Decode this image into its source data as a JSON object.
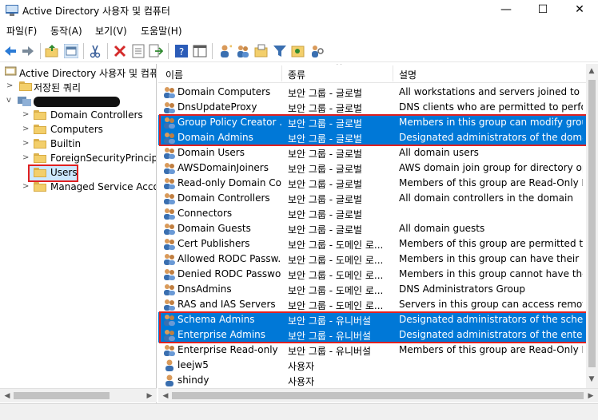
{
  "window": {
    "title": "Active Directory 사용자 및 컴퓨터",
    "minimize": "—",
    "maximize": "☐",
    "close": "✕"
  },
  "menu": [
    "파일(F)",
    "동작(A)",
    "보기(V)",
    "도움말(H)"
  ],
  "tree": {
    "root": "Active Directory 사용자 및 컴퓨터",
    "saved_queries": "저장된 쿼리",
    "domain_redacted": "",
    "children": [
      "Domain Controllers",
      "Computers",
      "Builtin",
      "ForeignSecurityPrincipal",
      "Users",
      "Managed Service Accou"
    ]
  },
  "list": {
    "headers": {
      "name": "이름",
      "type": "종류",
      "desc": "설명"
    },
    "rows": [
      {
        "name": "Domain Computers",
        "type": "보안 그룹 - 글로벌",
        "desc": "All workstations and servers joined to the...",
        "icon": "group-icon",
        "selected": false
      },
      {
        "name": "DnsUpdateProxy",
        "type": "보안 그룹 - 글로벌",
        "desc": "DNS clients who are permitted to perfor...",
        "icon": "group-icon",
        "selected": false
      },
      {
        "name": "Group Policy Creator ...",
        "type": "보안 그룹 - 글로벌",
        "desc": "Members in this group can modify grou...",
        "icon": "group-icon",
        "selected": true
      },
      {
        "name": "Domain Admins",
        "type": "보안 그룹 - 글로벌",
        "desc": "Designated administrators of the domain",
        "icon": "group-icon",
        "selected": true
      },
      {
        "name": "Domain Users",
        "type": "보안 그룹 - 글로벌",
        "desc": "All domain users",
        "icon": "group-icon",
        "selected": false
      },
      {
        "name": "AWSDomainJoiners",
        "type": "보안 그룹 - 글로벌",
        "desc": "AWS domain join group for directory op...",
        "icon": "group-icon",
        "selected": false
      },
      {
        "name": "Read-only Domain Co...",
        "type": "보안 그룹 - 글로벌",
        "desc": "Members of this group are Read-Only D...",
        "icon": "group-icon",
        "selected": false
      },
      {
        "name": "Domain Controllers",
        "type": "보안 그룹 - 글로벌",
        "desc": "All domain controllers in the domain",
        "icon": "group-icon",
        "selected": false
      },
      {
        "name": "Connectors",
        "type": "보안 그룹 - 글로벌",
        "desc": "",
        "icon": "group-icon",
        "selected": false
      },
      {
        "name": "Domain Guests",
        "type": "보안 그룹 - 글로벌",
        "desc": "All domain guests",
        "icon": "group-icon",
        "selected": false
      },
      {
        "name": "Cert Publishers",
        "type": "보안 그룹 - 도메인 로...",
        "desc": "Members of this group are permitted to ...",
        "icon": "group-icon",
        "selected": false
      },
      {
        "name": "Allowed RODC Passw...",
        "type": "보안 그룹 - 도메인 로...",
        "desc": "Members in this group can have their pa...",
        "icon": "group-icon",
        "selected": false
      },
      {
        "name": "Denied RODC Passwo...",
        "type": "보안 그룹 - 도메인 로...",
        "desc": "Members in this group cannot have their...",
        "icon": "group-icon",
        "selected": false
      },
      {
        "name": "DnsAdmins",
        "type": "보안 그룹 - 도메인 로...",
        "desc": "DNS Administrators Group",
        "icon": "group-icon",
        "selected": false
      },
      {
        "name": "RAS and IAS Servers",
        "type": "보안 그룹 - 도메인 로...",
        "desc": "Servers in this group can access remote ...",
        "icon": "group-icon",
        "selected": false
      },
      {
        "name": "Schema Admins",
        "type": "보안 그룹 - 유니버설",
        "desc": "Designated administrators of the schema",
        "icon": "group-icon",
        "selected": true
      },
      {
        "name": "Enterprise Admins",
        "type": "보안 그룹 - 유니버설",
        "desc": "Designated administrators of the enterpri...",
        "icon": "group-icon",
        "selected": true
      },
      {
        "name": "Enterprise Read-only ...",
        "type": "보안 그룹 - 유니버설",
        "desc": "Members of this group are Read-Only D...",
        "icon": "group-icon",
        "selected": false
      },
      {
        "name": "leejw5",
        "type": "사용자",
        "desc": "",
        "icon": "user-icon",
        "selected": false
      },
      {
        "name": "shindy",
        "type": "사용자",
        "desc": "",
        "icon": "user-icon",
        "selected": false
      }
    ]
  },
  "colors": {
    "selection": "#0078d7",
    "highlight_box": "#e02020"
  }
}
